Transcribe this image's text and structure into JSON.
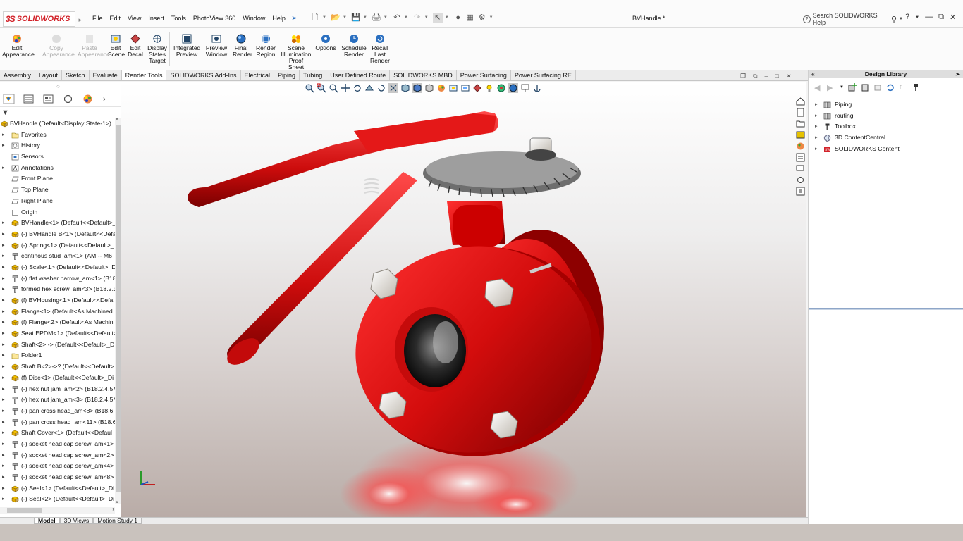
{
  "app": {
    "logo_prefix": "3S",
    "logo_text": "SOLIDWORKS",
    "document_title": "BVHandle *"
  },
  "menu": [
    "File",
    "Edit",
    "View",
    "Insert",
    "Tools",
    "PhotoView 360",
    "Window",
    "Help"
  ],
  "help_search": {
    "placeholder": "Search SOLIDWORKS Help"
  },
  "ribbon": [
    {
      "label": "Edit Appearance",
      "enabled": true,
      "icon": "appearance-icon"
    },
    {
      "label": "Copy Appearance",
      "enabled": false,
      "icon": "copy-appearance-icon"
    },
    {
      "label": "Paste Appearance",
      "enabled": false,
      "icon": "paste-appearance-icon"
    },
    {
      "label": "Edit Scene",
      "enabled": true,
      "icon": "scene-icon"
    },
    {
      "label": "Edit Decal",
      "enabled": true,
      "icon": "decal-icon"
    },
    {
      "label": "Display States Target",
      "enabled": true,
      "icon": "display-states-icon"
    },
    {
      "label": "Integrated Preview",
      "enabled": true,
      "icon": "integrated-preview-icon"
    },
    {
      "label": "Preview Window",
      "enabled": true,
      "icon": "preview-window-icon"
    },
    {
      "label": "Final Render",
      "enabled": true,
      "icon": "final-render-icon"
    },
    {
      "label": "Render Region",
      "enabled": true,
      "icon": "render-region-icon"
    },
    {
      "label": "Scene Illumination Proof Sheet",
      "enabled": true,
      "icon": "illumination-icon"
    },
    {
      "label": "Options",
      "enabled": true,
      "icon": "options-icon"
    },
    {
      "label": "Schedule Render",
      "enabled": true,
      "icon": "schedule-render-icon"
    },
    {
      "label": "Recall Last Render",
      "enabled": true,
      "icon": "recall-render-icon"
    }
  ],
  "tabs": [
    "Assembly",
    "Layout",
    "Sketch",
    "Evaluate",
    "Render Tools",
    "SOLIDWORKS Add-Ins",
    "Electrical",
    "Piping",
    "Tubing",
    "User Defined Route",
    "SOLIDWORKS MBD",
    "Power Surfacing",
    "Power Surfacing RE"
  ],
  "active_tab": "Render Tools",
  "tree": {
    "root": "BVHandle  (Default<Display State-1>)",
    "items": [
      {
        "label": "Favorites",
        "icon": "folder-icon",
        "expandable": true
      },
      {
        "label": "History",
        "icon": "history-icon",
        "expandable": true
      },
      {
        "label": "Sensors",
        "icon": "sensor-icon",
        "expandable": false
      },
      {
        "label": "Annotations",
        "icon": "annotation-icon",
        "expandable": true
      },
      {
        "label": "Front Plane",
        "icon": "plane-icon",
        "expandable": false
      },
      {
        "label": "Top Plane",
        "icon": "plane-icon",
        "expandable": false
      },
      {
        "label": "Right Plane",
        "icon": "plane-icon",
        "expandable": false
      },
      {
        "label": "Origin",
        "icon": "origin-icon",
        "expandable": false
      },
      {
        "label": "BVHandle<1> (Default<<Default>_",
        "icon": "part-icon",
        "expandable": true
      },
      {
        "label": "(-) BVHandle B<1> (Default<<Defa",
        "icon": "part-icon",
        "expandable": true
      },
      {
        "label": "(-) Spring<1> (Default<<Default>_",
        "icon": "part-icon",
        "expandable": true
      },
      {
        "label": "continous stud_am<1> (AM -- M6",
        "icon": "fastener-icon",
        "expandable": true
      },
      {
        "label": "(-) Scale<1> (Default<<Default>_D",
        "icon": "part-icon",
        "expandable": true
      },
      {
        "label": "(-) flat washer narrow_am<1> (B18",
        "icon": "fastener-icon",
        "expandable": true
      },
      {
        "label": "formed hex screw_am<3> (B18.2.3",
        "icon": "fastener-icon",
        "expandable": true
      },
      {
        "label": "(f) BVHousing<1> (Default<<Defa",
        "icon": "part-icon",
        "expandable": true
      },
      {
        "label": "Flange<1> (Default<As Machined",
        "icon": "part-icon",
        "expandable": true
      },
      {
        "label": "(f) Flange<2> (Default<As Machin",
        "icon": "part-icon",
        "expandable": true
      },
      {
        "label": "Seat EPDM<1> (Default<<Default>",
        "icon": "part-icon",
        "expandable": true
      },
      {
        "label": "Shaft<2> -> (Default<<Default>_D",
        "icon": "part-icon",
        "expandable": true
      },
      {
        "label": "Folder1",
        "icon": "folder-icon",
        "expandable": true
      },
      {
        "label": "Shaft B<2>->? (Default<<Default>",
        "icon": "part-icon",
        "expandable": true
      },
      {
        "label": "(f) Disc<1> (Default<<Default>_Di",
        "icon": "part-icon",
        "expandable": true
      },
      {
        "label": "(-) hex nut jam_am<2> (B18.2.4.5M",
        "icon": "fastener-icon",
        "expandable": true
      },
      {
        "label": "(-) hex nut jam_am<3> (B18.2.4.5M",
        "icon": "fastener-icon",
        "expandable": true
      },
      {
        "label": "(-) pan cross head_am<8> (B18.6.7",
        "icon": "fastener-icon",
        "expandable": true
      },
      {
        "label": "(-) pan cross head_am<11> (B18.6",
        "icon": "fastener-icon",
        "expandable": true
      },
      {
        "label": "Shaft  Cover<1> (Default<<Defaul",
        "icon": "part-icon",
        "expandable": true
      },
      {
        "label": "(-) socket head cap screw_am<1>",
        "icon": "fastener-icon",
        "expandable": true
      },
      {
        "label": "(-) socket head cap screw_am<2>",
        "icon": "fastener-icon",
        "expandable": true
      },
      {
        "label": "(-) socket head cap screw_am<4>",
        "icon": "fastener-icon",
        "expandable": true
      },
      {
        "label": "(-) socket head cap screw_am<8>",
        "icon": "fastener-icon",
        "expandable": true
      },
      {
        "label": "(-) Seal<1> (Default<<Default>_Di",
        "icon": "part-icon",
        "expandable": true
      },
      {
        "label": "(-) Seal<2> (Default<<Default>_Di",
        "icon": "part-icon",
        "expandable": true
      }
    ]
  },
  "bottom_tabs": [
    "Model",
    "3D Views",
    "Motion Study 1"
  ],
  "active_bottom_tab": "Model",
  "design_library": {
    "title": "Design Library",
    "items": [
      {
        "label": "Piping",
        "icon": "library-folder-icon"
      },
      {
        "label": "routing",
        "icon": "library-folder-icon"
      },
      {
        "label": "Toolbox",
        "icon": "toolbox-icon"
      },
      {
        "label": "3D ContentCentral",
        "icon": "globe-icon"
      },
      {
        "label": "SOLIDWORKS Content",
        "icon": "sw-content-icon"
      }
    ]
  },
  "colors": {
    "valve_red": "#d40d0d",
    "brand_red": "#d2232a"
  }
}
